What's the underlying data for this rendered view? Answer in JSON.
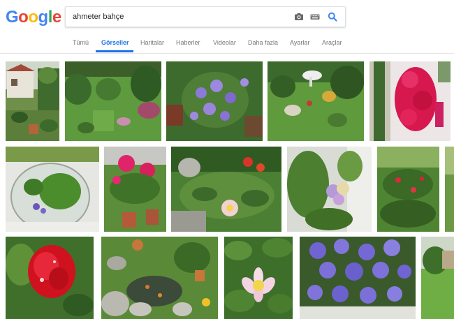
{
  "logo": {
    "letters": [
      "G",
      "o",
      "o",
      "g",
      "l",
      "e"
    ],
    "colors": [
      "#4285F4",
      "#EA4335",
      "#FBBC05",
      "#4285F4",
      "#34A853",
      "#EA4335"
    ]
  },
  "search": {
    "query": "ahmeter bahçe",
    "icons": [
      "camera-icon",
      "keyboard-icon",
      "search-icon"
    ]
  },
  "tabs": [
    {
      "label": "Tümü",
      "active": false
    },
    {
      "label": "Görseller",
      "active": true
    },
    {
      "label": "Haritalar",
      "active": false
    },
    {
      "label": "Haberler",
      "active": false
    },
    {
      "label": "Videolar",
      "active": false
    },
    {
      "label": "Daha fazla",
      "active": false
    },
    {
      "label": "Ayarlar",
      "active": false
    },
    {
      "label": "Araçlar",
      "active": false
    }
  ],
  "colors": {
    "accent": "#1a73e8"
  }
}
